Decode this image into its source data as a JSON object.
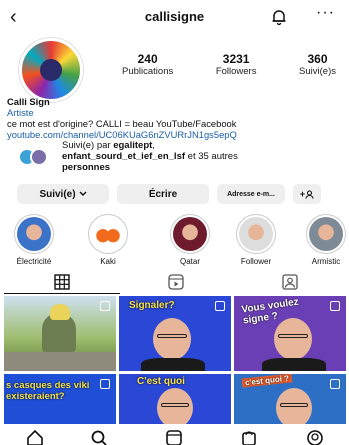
{
  "header": {
    "back_icon": "‹",
    "username": "callisigne",
    "more_icon": "···"
  },
  "stats": [
    {
      "num": "240",
      "label": "Publications"
    },
    {
      "num": "3231",
      "label": "Followers"
    },
    {
      "num": "360",
      "label": "Suivi(e)s"
    }
  ],
  "bio": {
    "name": "Calli Sign",
    "category": "Artiste",
    "text": "ce mot est d'origine? CALLI = beau YouTube/Facebook",
    "link": "youtube.com/channel/UC06KUaG6nZVURrJN1gs5epQ"
  },
  "followed_by": {
    "prefix": "Suivi(e) par ",
    "user1": "egalitept",
    "sep": ",",
    "line2_user": "enfant_sourd_et_ief_en_lsf",
    "suffix": " et 35 autres",
    "line3": "personnes"
  },
  "buttons": {
    "suivi": "Suivi(e)",
    "ecrire": "Écrire",
    "adresse": "Adresse e-m...",
    "add_person": "+"
  },
  "stories": [
    {
      "label": "Électricité"
    },
    {
      "label": "Kaki"
    },
    {
      "label": "Qatar"
    },
    {
      "label": "Follower"
    },
    {
      "label": "Armistic"
    }
  ],
  "grid": {
    "cell2_caption": "Signaler?",
    "cell3_caption": "Vous voulez signe ?",
    "cell4_caption": "s casques des viki existeraient?",
    "cell5_caption": "C'est quoi",
    "cell6_caption": "c'est quoi ?"
  },
  "colors": {
    "link": "#1a5fa8",
    "button_bg": "#efefef"
  }
}
